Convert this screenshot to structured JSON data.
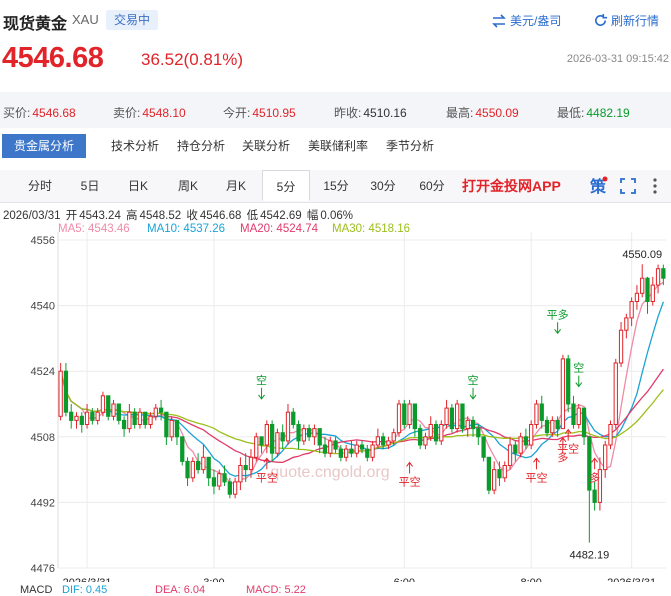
{
  "header": {
    "title": "现货黄金",
    "code": "XAU",
    "status": "交易中",
    "currency_btn": "美元/盎司",
    "refresh_btn": "刷新行情",
    "price": "4546.68",
    "change": "36.52(0.81%)",
    "timestamp": "2026-03-31 09:15:42",
    "colors": {
      "up": "#e0242a",
      "down": "#0a9b2c",
      "accent": "#3e77c9"
    }
  },
  "stats": [
    {
      "label": "买价:",
      "value": "4546.68",
      "color": "red"
    },
    {
      "label": "卖价:",
      "value": "4548.10",
      "color": "red"
    },
    {
      "label": "今开:",
      "value": "4510.95",
      "color": "red"
    },
    {
      "label": "昨收:",
      "value": "4510.16",
      "color": "dark"
    },
    {
      "label": "最高:",
      "value": "4550.09",
      "color": "red"
    },
    {
      "label": "最低:",
      "value": "4482.19",
      "color": "green"
    }
  ],
  "analysis_tabs": [
    "贵金属分析",
    "技术分析",
    "持仓分析",
    "关联分析",
    "美联储利率",
    "季节分析"
  ],
  "period_tabs": [
    "分时",
    "5日",
    "日K",
    "周K",
    "月K",
    "5分",
    "15分",
    "30分",
    "60分"
  ],
  "active_period": "5分",
  "app_link": "打开金投网APP",
  "icons": [
    "policy-icon",
    "fullscreen-icon",
    "more-icon"
  ],
  "info": {
    "date": "2026/03/31",
    "open_label": "开",
    "open": "4543.24",
    "high_label": "高",
    "high": "4548.52",
    "close_label": "收",
    "close": "4546.68",
    "low_label": "低",
    "low": "4542.69",
    "amp_label": "幅",
    "amp": "0.06%"
  },
  "ma_legend": [
    {
      "text": "MA5: 4543.46",
      "color": "#f08aa8"
    },
    {
      "text": "MA10: 4537.26",
      "color": "#1aa3d6"
    },
    {
      "text": "MA20: 4524.74",
      "color": "#e03a6b"
    },
    {
      "text": "MA30: 4518.16",
      "color": "#9cbf1a"
    }
  ],
  "macd_legend": [
    {
      "text": "MACD",
      "color": "#333"
    },
    {
      "text": "DIF: 0.45",
      "color": "#1aa3d6"
    },
    {
      "text": "DEA: 6.04",
      "color": "#e03a6b"
    },
    {
      "text": "MACD: 5.22",
      "color": "#e03a6b"
    }
  ],
  "watermark": "quote.cngold.org",
  "chart_data": {
    "type": "candlestick",
    "ylim": [
      4476,
      4556
    ],
    "y_ticks": [
      4476,
      4492,
      4508,
      4524,
      4540,
      4556
    ],
    "x_labels": [
      {
        "text": "2026/3/31",
        "index": 5
      },
      {
        "text": "3:00",
        "index": 29
      },
      {
        "text": "6:00",
        "index": 65
      },
      {
        "text": "8:00",
        "index": 89
      },
      {
        "text": "2026/3/31",
        "index": 108
      }
    ],
    "candles": [
      [
        4513.0,
        4524.0,
        4526.0,
        4512.0
      ],
      [
        4524.0,
        4514.0,
        4526.0,
        4513.0
      ],
      [
        4514.0,
        4512.0,
        4516.0,
        4510.0
      ],
      [
        4512.0,
        4513.0,
        4514.0,
        4510.0
      ],
      [
        4513.0,
        4511.0,
        4514.0,
        4509.0
      ],
      [
        4511.0,
        4514.0,
        4516.0,
        4510.0
      ],
      [
        4514.0,
        4512.0,
        4515.0,
        4511.0
      ],
      [
        4512.0,
        4514.0,
        4515.0,
        4511.0
      ],
      [
        4514.0,
        4518.0,
        4519.0,
        4513.0
      ],
      [
        4518.0,
        4513.0,
        4518.0,
        4512.0
      ],
      [
        4513.0,
        4516.0,
        4517.0,
        4512.0
      ],
      [
        4516.0,
        4512.0,
        4516.0,
        4511.0
      ],
      [
        4512.0,
        4510.0,
        4513.0,
        4508.0
      ],
      [
        4510.0,
        4514.0,
        4516.0,
        4509.0
      ],
      [
        4514.0,
        4511.0,
        4515.0,
        4510.0
      ],
      [
        4511.0,
        4514.0,
        4515.0,
        4510.0
      ],
      [
        4514.0,
        4511.0,
        4514.0,
        4510.0
      ],
      [
        4511.0,
        4513.0,
        4514.0,
        4510.0
      ],
      [
        4513.0,
        4515.0,
        4516.0,
        4512.0
      ],
      [
        4515.0,
        4514.0,
        4517.0,
        4512.0
      ],
      [
        4514.0,
        4508.0,
        4514.0,
        4506.0
      ],
      [
        4508.0,
        4512.0,
        4513.0,
        4507.0
      ],
      [
        4512.0,
        4508.0,
        4512.0,
        4506.0
      ],
      [
        4508.0,
        4502.0,
        4508.0,
        4501.0
      ],
      [
        4502.0,
        4498.0,
        4503.0,
        4496.0
      ],
      [
        4498.0,
        4502.0,
        4503.0,
        4497.0
      ],
      [
        4502.0,
        4500.0,
        4504.0,
        4499.0
      ],
      [
        4500.0,
        4503.0,
        4506.0,
        4499.0
      ],
      [
        4503.0,
        4498.0,
        4503.0,
        4496.0
      ],
      [
        4498.0,
        4496.0,
        4500.0,
        4494.0
      ],
      [
        4496.0,
        4499.0,
        4500.0,
        4495.0
      ],
      [
        4499.0,
        4497.0,
        4501.0,
        4496.0
      ],
      [
        4497.0,
        4494.0,
        4498.0,
        4493.0
      ],
      [
        4494.0,
        4497.0,
        4498.0,
        4493.0
      ],
      [
        4497.0,
        4501.0,
        4503.0,
        4495.0
      ],
      [
        4501.0,
        4500.0,
        4504.0,
        4497.0
      ],
      [
        4500.0,
        4503.0,
        4505.0,
        4498.0
      ],
      [
        4503.0,
        4508.0,
        4509.0,
        4502.0
      ],
      [
        4508.0,
        4506.0,
        4508.0,
        4504.0
      ],
      [
        4506.0,
        4511.0,
        4512.0,
        4504.0
      ],
      [
        4511.0,
        4504.0,
        4512.0,
        4502.0
      ],
      [
        4504.0,
        4509.0,
        4510.0,
        4503.0
      ],
      [
        4509.0,
        4507.0,
        4511.0,
        4505.0
      ],
      [
        4507.0,
        4514.0,
        4516.0,
        4506.0
      ],
      [
        4514.0,
        4511.0,
        4515.0,
        4510.0
      ],
      [
        4511.0,
        4507.0,
        4512.0,
        4505.0
      ],
      [
        4507.0,
        4510.0,
        4511.0,
        4506.0
      ],
      [
        4510.0,
        4508.0,
        4511.0,
        4507.0
      ],
      [
        4508.0,
        4510.0,
        4511.0,
        4506.0
      ],
      [
        4510.0,
        4506.0,
        4510.0,
        4504.0
      ],
      [
        4506.0,
        4504.0,
        4508.0,
        4503.0
      ],
      [
        4504.0,
        4507.0,
        4508.0,
        4503.0
      ],
      [
        4507.0,
        4505.0,
        4508.0,
        4504.0
      ],
      [
        4505.0,
        4503.0,
        4506.0,
        4502.0
      ],
      [
        4503.0,
        4505.0,
        4506.0,
        4502.0
      ],
      [
        4505.0,
        4504.0,
        4507.0,
        4503.0
      ],
      [
        4504.0,
        4506.0,
        4507.0,
        4503.0
      ],
      [
        4506.0,
        4505.0,
        4507.0,
        4504.0
      ],
      [
        4505.0,
        4503.0,
        4506.0,
        4502.0
      ],
      [
        4503.0,
        4506.0,
        4507.0,
        4502.0
      ],
      [
        4506.0,
        4508.0,
        4510.0,
        4505.0
      ],
      [
        4508.0,
        4506.0,
        4509.0,
        4505.0
      ],
      [
        4506.0,
        4507.0,
        4508.0,
        4505.0
      ],
      [
        4507.0,
        4509.0,
        4510.0,
        4506.0
      ],
      [
        4509.0,
        4516.0,
        4517.0,
        4508.0
      ],
      [
        4516.0,
        4511.0,
        4517.0,
        4510.0
      ],
      [
        4511.0,
        4516.0,
        4517.0,
        4510.0
      ],
      [
        4516.0,
        4510.0,
        4516.0,
        4508.0
      ],
      [
        4510.0,
        4506.0,
        4511.0,
        4505.0
      ],
      [
        4506.0,
        4508.0,
        4509.0,
        4505.0
      ],
      [
        4508.0,
        4511.0,
        4513.0,
        4507.0
      ],
      [
        4511.0,
        4507.0,
        4512.0,
        4506.0
      ],
      [
        4507.0,
        4511.0,
        4512.0,
        4506.0
      ],
      [
        4511.0,
        4515.0,
        4517.0,
        4510.0
      ],
      [
        4515.0,
        4510.0,
        4516.0,
        4509.0
      ],
      [
        4510.0,
        4516.0,
        4517.0,
        4509.0
      ],
      [
        4516.0,
        4510.0,
        4516.0,
        4509.0
      ],
      [
        4510.0,
        4512.0,
        4513.0,
        4508.0
      ],
      [
        4512.0,
        4510.0,
        4513.0,
        4508.0
      ],
      [
        4510.0,
        4508.0,
        4511.0,
        4506.0
      ],
      [
        4508.0,
        4503.0,
        4508.0,
        4502.0
      ],
      [
        4503.0,
        4495.0,
        4503.0,
        4494.0
      ],
      [
        4495.0,
        4500.0,
        4502.0,
        4494.0
      ],
      [
        4500.0,
        4498.0,
        4502.0,
        4496.0
      ],
      [
        4498.0,
        4501.0,
        4502.0,
        4497.0
      ],
      [
        4501.0,
        4506.0,
        4508.0,
        4500.0
      ],
      [
        4506.0,
        4504.0,
        4507.0,
        4502.0
      ],
      [
        4504.0,
        4508.0,
        4509.0,
        4503.0
      ],
      [
        4508.0,
        4506.0,
        4510.0,
        4505.0
      ],
      [
        4506.0,
        4511.0,
        4512.0,
        4505.0
      ],
      [
        4511.0,
        4516.0,
        4517.0,
        4510.0
      ],
      [
        4516.0,
        4512.0,
        4518.0,
        4510.0
      ],
      [
        4512.0,
        4509.0,
        4513.0,
        4508.0
      ],
      [
        4509.0,
        4512.0,
        4513.0,
        4508.0
      ],
      [
        4512.0,
        4510.0,
        4513.0,
        4508.0
      ],
      [
        4510.0,
        4527.0,
        4528.0,
        4510.0
      ],
      [
        4527.0,
        4516.0,
        4528.0,
        4514.0
      ],
      [
        4516.0,
        4511.0,
        4518.0,
        4510.0
      ],
      [
        4511.0,
        4515.0,
        4516.0,
        4510.0
      ],
      [
        4515.0,
        4508.0,
        4515.0,
        4506.0
      ],
      [
        4508.0,
        4495.0,
        4508.0,
        4482.19
      ],
      [
        4495.0,
        4492.0,
        4497.0,
        4490.0
      ],
      [
        4492.0,
        4500.0,
        4503.0,
        4490.0
      ],
      [
        4500.0,
        4506.0,
        4507.0,
        4498.0
      ],
      [
        4506.0,
        4511.0,
        4512.0,
        4505.0
      ],
      [
        4511.0,
        4526.0,
        4527.0,
        4510.0
      ],
      [
        4526.0,
        4534.0,
        4536.0,
        4525.0
      ],
      [
        4534.0,
        4537.0,
        4538.0,
        4532.0
      ],
      [
        4537.0,
        4541.0,
        4542.0,
        4535.0
      ],
      [
        4541.0,
        4543.0,
        4545.0,
        4539.0
      ],
      [
        4543.0,
        4546.68,
        4550.09,
        4542.0
      ],
      [
        4546.68,
        4541.0,
        4547.0,
        4538.0
      ],
      [
        4541.0,
        4545.0,
        4547.0,
        4540.0
      ],
      [
        4545.0,
        4549.0,
        4550.0,
        4543.0
      ],
      [
        4549.0,
        4546.68,
        4550.0,
        4545.0
      ]
    ],
    "annotations": [
      {
        "text": "4550.09",
        "index": 110,
        "y": 4550.09,
        "pos": "above"
      },
      {
        "text": "4482.19",
        "index": 100,
        "y": 4482.19,
        "pos": "below"
      }
    ],
    "signals": [
      {
        "text": "空",
        "index": 38,
        "y": 4517,
        "dir": "down"
      },
      {
        "text": "平空",
        "index": 39,
        "y": 4503,
        "dir": "up"
      },
      {
        "text": "平空",
        "index": 66,
        "y": 4502,
        "dir": "up"
      },
      {
        "text": "空",
        "index": 78,
        "y": 4517,
        "dir": "down"
      },
      {
        "text": "平空",
        "index": 90,
        "y": 4503,
        "dir": "up"
      },
      {
        "text": "平多",
        "index": 94,
        "y": 4533,
        "dir": "down"
      },
      {
        "text": "空",
        "index": 98,
        "y": 4520,
        "dir": "down"
      },
      {
        "text": "多",
        "index": 95,
        "y": 4508,
        "dir": "up"
      },
      {
        "text": "平空",
        "index": 96,
        "y": 4510,
        "dir": "up"
      },
      {
        "text": "多",
        "index": 101,
        "y": 4503,
        "dir": "up"
      }
    ],
    "ma": {
      "MA5": "#f08aa8",
      "MA10": "#1aa3d6",
      "MA20": "#e03a6b",
      "MA30": "#9cbf1a"
    }
  }
}
